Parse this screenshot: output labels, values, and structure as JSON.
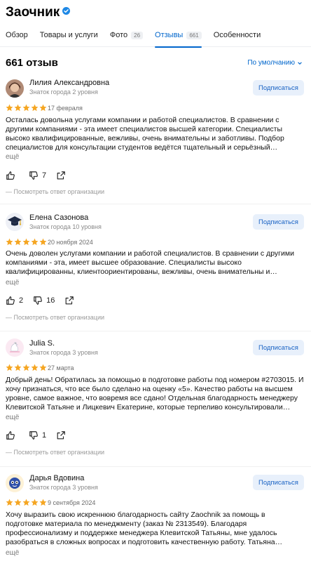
{
  "header": {
    "title": "Заочник",
    "verified_icon": "verified-check-icon"
  },
  "tabs": [
    {
      "label": "Обзор",
      "count": ""
    },
    {
      "label": "Товары и услуги",
      "count": ""
    },
    {
      "label": "Фото",
      "count": "26"
    },
    {
      "label": "Отзывы",
      "count": "661",
      "active": true
    },
    {
      "label": "Особенности",
      "count": ""
    }
  ],
  "summary": {
    "count_label": "661 отзыв",
    "sort_label": "По умолчанию"
  },
  "colors": {
    "accent": "#0066cc",
    "star": "#f5a623",
    "subscribe_bg": "#e8f0fb"
  },
  "reviews": [
    {
      "author": "Лилия Александровна",
      "level": "Знаток города 2 уровня",
      "subscribe": "Подписаться",
      "rating": 5,
      "date": "17 февраля",
      "text": "Осталась довольна услугами компании и работой специалистов. В сравнении с другими компаниями - эта имеет специалистов высшей категории. Специалисты высоко квалифицированные, вежливы, очень внимательны и заботливы. Подбор специалистов для консультации студентов ведётся тщательный и серьёзный…",
      "more": "ещё",
      "likes": "",
      "dislikes": "7",
      "answer": "— Посмотреть ответ организации"
    },
    {
      "author": "Елена Сазонова",
      "level": "Знаток города 10 уровня",
      "subscribe": "Подписаться",
      "rating": 5,
      "date": "20 ноября 2024",
      "text": "Очень доволен услугами компании и работой специалистов. В сравнении с другими компаниями - эта, имеет высшее образование. Специалисты высоко квалифицированны, клиентоориентированы, вежливы, очень внимательны и…",
      "more": "ещё",
      "likes": "2",
      "dislikes": "16",
      "answer": "— Посмотреть ответ организации"
    },
    {
      "author": "Julia S.",
      "level": "Знаток города 3 уровня",
      "subscribe": "Подписаться",
      "rating": 5,
      "date": "27 марта",
      "text": "Добрый день! Обратилась за помощью в подготовке работы под номером #2703015. И хочу признаться, что все было сделано на оценку «5». Качество работы на высшем уровне, самое важное, что вовремя все сдано! Отдельная благодарность менеджеру Клевитской Татьяне и Лицкевич Екатерине, которые терпеливо консультировали…",
      "more": "ещё",
      "likes": "",
      "dislikes": "1",
      "answer": "— Посмотреть ответ организации"
    },
    {
      "author": "Дарья Вдовина",
      "level": "Знаток города 3 уровня",
      "subscribe": "Подписаться",
      "rating": 5,
      "date": "9 сентября 2024",
      "text": "Хочу выразить свою искреннюю благодарность сайту Zaochnik за помощь в подготовке материала по менеджменту (заказ № 2313549). Благодаря профессионализму и поддержке менеджера Клевитской Татьяны, мне удалось разобраться в сложных вопросах и подготовить качественную работу. Татьяна…",
      "more": "ещё"
    }
  ]
}
